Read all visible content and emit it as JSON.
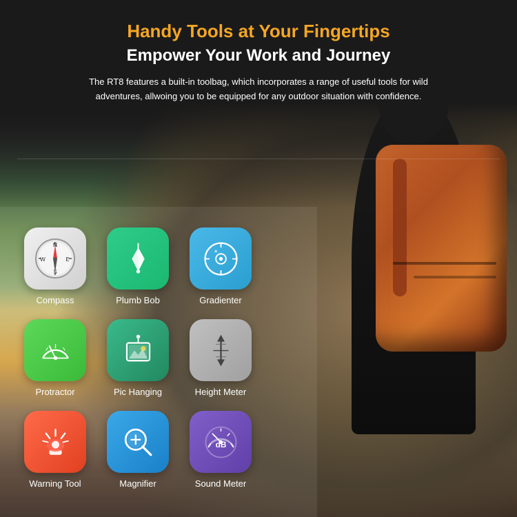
{
  "header": {
    "tagline": "Handy Tools at Your Fingertips",
    "title": "Empower Your Work and Journey",
    "description": "The RT8 features a built-in toolbag, which incorporates a range of useful tools for wild adventures, allwoing you to be equipped for any outdoor situation with confidence."
  },
  "tools": [
    {
      "id": "compass",
      "label": "Compass",
      "icon_type": "compass",
      "color_start": "#f0f0f0",
      "color_end": "#d0d0d0"
    },
    {
      "id": "plumb-bob",
      "label": "Plumb Bob",
      "icon_type": "plumb",
      "color_start": "#2ecc8a",
      "color_end": "#1ab870"
    },
    {
      "id": "gradienter",
      "label": "Gradienter",
      "icon_type": "gradienter",
      "color_start": "#4ab8e8",
      "color_end": "#2a9fd0"
    },
    {
      "id": "protractor",
      "label": "Protractor",
      "icon_type": "protractor",
      "color_start": "#5dd85a",
      "color_end": "#3aba38"
    },
    {
      "id": "pic-hanging",
      "label": "Pic Hanging",
      "icon_type": "pic-hanging",
      "color_start": "#3aba8a",
      "color_end": "#228860"
    },
    {
      "id": "height-meter",
      "label": "Height Meter",
      "icon_type": "height-meter",
      "color_start": "#c0c0c0",
      "color_end": "#909090"
    },
    {
      "id": "warning-tool",
      "label": "Warning Tool",
      "icon_type": "warning",
      "color_start": "#ff6b4a",
      "color_end": "#e04020"
    },
    {
      "id": "magnifier",
      "label": "Magnifier",
      "icon_type": "magnifier",
      "color_start": "#3aa8e8",
      "color_end": "#1a80c8"
    },
    {
      "id": "sound-meter",
      "label": "Sound Meter",
      "icon_type": "sound",
      "color_start": "#8060c8",
      "color_end": "#6040a8"
    }
  ]
}
